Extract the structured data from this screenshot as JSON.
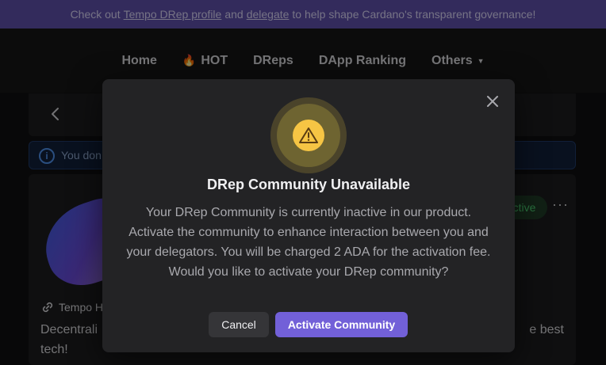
{
  "banner": {
    "prefix": "Check out",
    "link1": "Tempo DRep profile",
    "middle": "and",
    "link2": "delegate",
    "suffix": "to help shape Cardano's transparent governance!"
  },
  "nav": {
    "items": [
      {
        "label": "Home"
      },
      {
        "label": "HOT"
      },
      {
        "label": "DReps"
      },
      {
        "label": "DApp Ranking"
      },
      {
        "label": "Others"
      }
    ]
  },
  "page": {
    "info_text": "You don",
    "status_badge": "ctive",
    "more_label": "···",
    "link_label": "Tempo H",
    "description_line1": "Decentrali",
    "description_line1_end": "e best",
    "description_line2": "tech!"
  },
  "modal": {
    "title": "DRep Community Unavailable",
    "body": "Your DRep Community is currently inactive in our product. Activate the community to enhance interaction between you and your delegators. You will be charged 2 ADA for the activation fee. Would you like to activate your DRep community?",
    "cancel_label": "Cancel",
    "activate_label": "Activate Community"
  },
  "colors": {
    "banner_bg": "#5d4fa8",
    "accent": "#7260d8",
    "warning": "#f6c544",
    "status_green": "#4ccf72"
  }
}
